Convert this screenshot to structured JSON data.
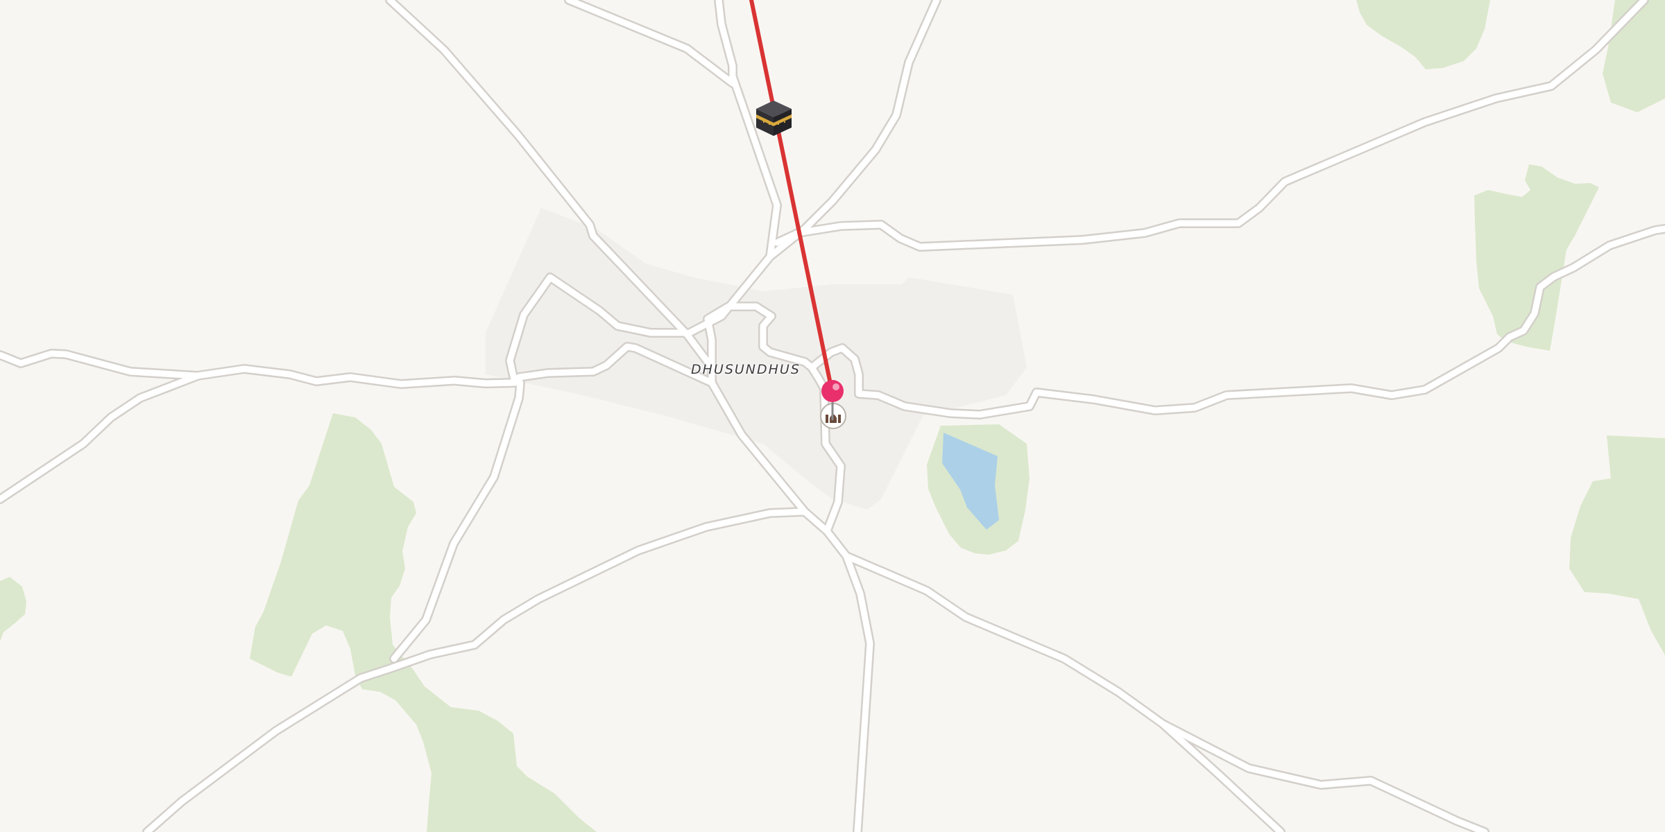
{
  "map": {
    "place_label": "DHUSUNDHUS",
    "icons": {
      "landmark": "kaaba-icon",
      "location_pin": "map-pin-icon",
      "poi": "mosque-icon"
    },
    "route_line": "qibla-direction-line",
    "colors": {
      "background": "#f8f6f2",
      "town_area": "#f1efec",
      "vegetation": "#dbe8cd",
      "water": "#acd0e8",
      "road_casing": "#d3cfca",
      "road_fill": "#ffffff",
      "route": "#d93333",
      "pin": "#e9306c"
    }
  }
}
